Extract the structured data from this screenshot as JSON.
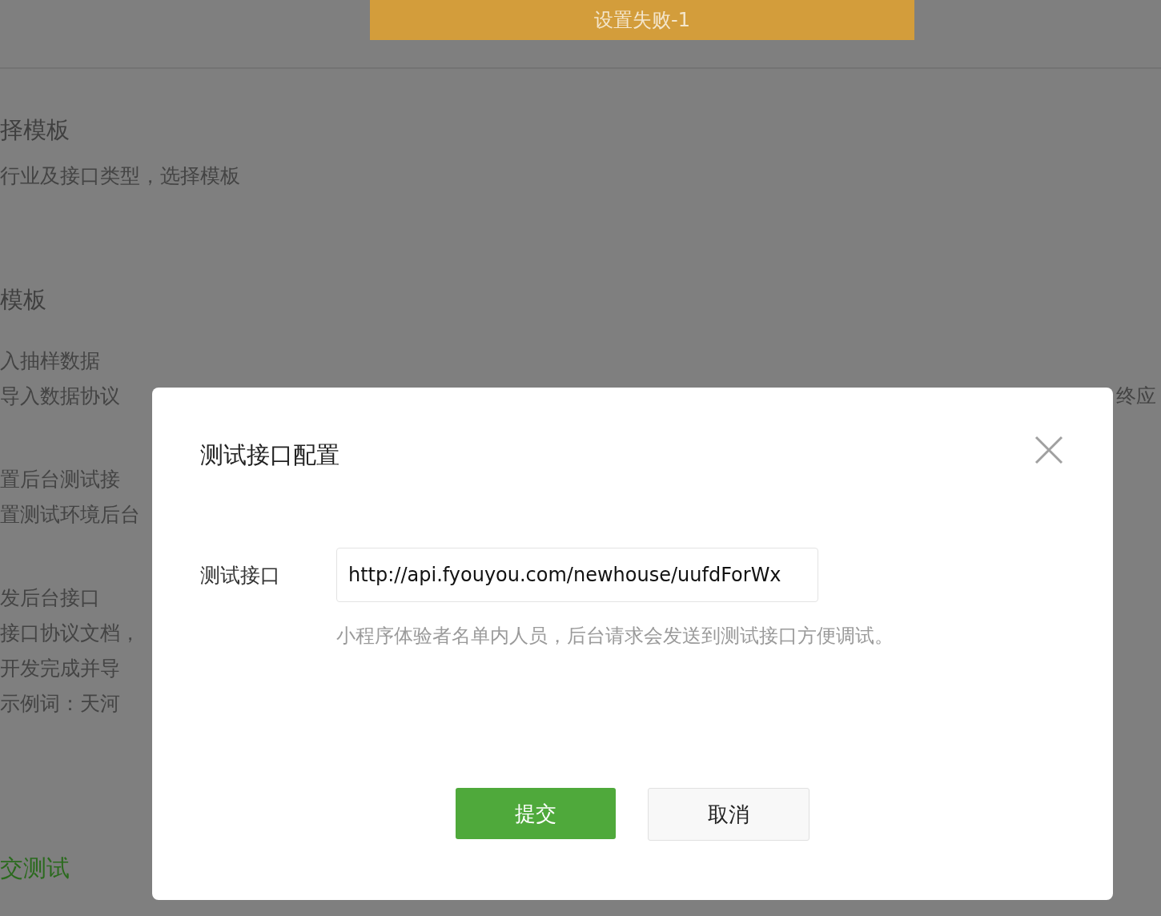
{
  "toast": {
    "text": "设置失败-1"
  },
  "page": {
    "sections": [
      {
        "heading": "择模板",
        "kind": "plain",
        "steps": [
          {
            "lines": [
              {
                "text": "行业及接口类型，选择模板"
              }
            ]
          }
        ]
      },
      {
        "heading": "模板",
        "kind": "plain",
        "steps": [
          {
            "title": "入抽样数据",
            "lines": [
              {
                "text": "导入数据协议",
                "right": "终应"
              }
            ]
          },
          {
            "title": "置后台测试接",
            "lines": [
              {
                "text": "置测试环境后台"
              }
            ]
          },
          {
            "title": "发后台接口",
            "lines": [
              {
                "text": "接口协议文档，"
              },
              {
                "text": "开发完成并导"
              },
              {
                "text": "示例词：天河"
              }
            ]
          }
        ]
      },
      {
        "heading": "交测试",
        "kind": "action"
      }
    ]
  },
  "dialog": {
    "title": "测试接口配置",
    "field": {
      "label": "测试接口",
      "value": "http://api.fyouyou.com/newhouse/uufdForWx",
      "hint": "小程序体验者名单内人员，后台请求会发送到测试接口方便调试。"
    },
    "buttons": [
      {
        "label": "提交",
        "kind": "primary"
      },
      {
        "label": "取消",
        "kind": "secondary"
      }
    ]
  }
}
